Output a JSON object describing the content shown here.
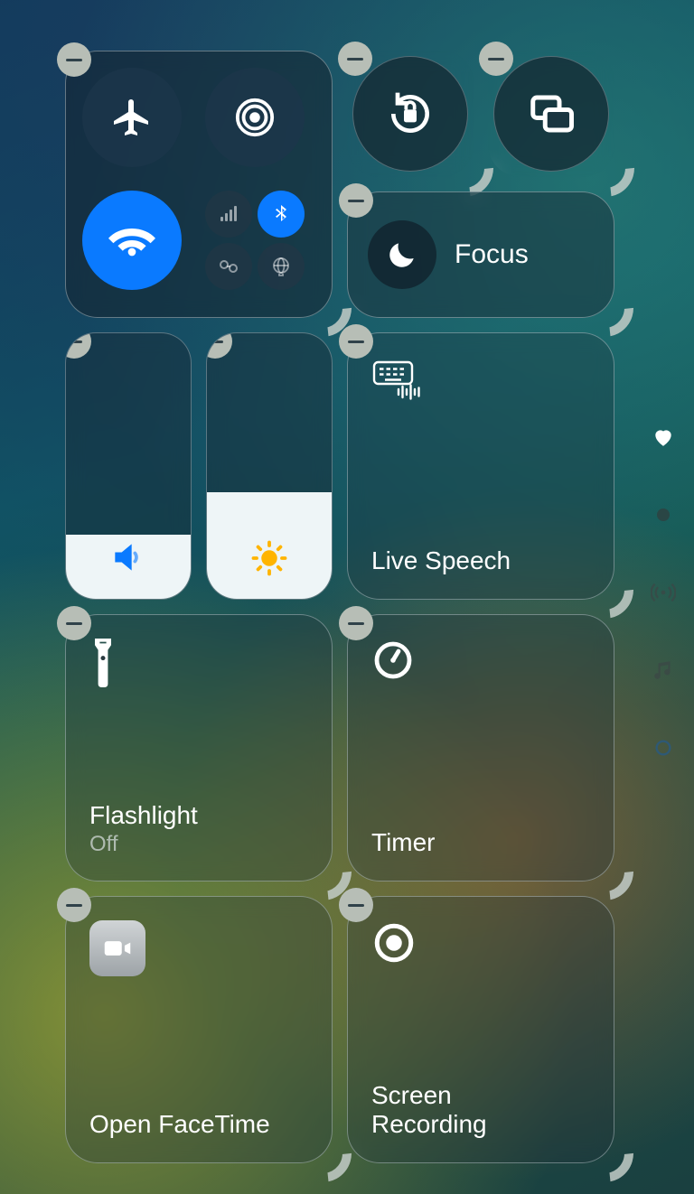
{
  "connectivity": {
    "airplane_on": false,
    "airdrop_on": false,
    "wifi_on": true,
    "cellular_on": false,
    "bluetooth_on": true,
    "hotspot_on": false,
    "vpn_on": false
  },
  "focus": {
    "label": "Focus"
  },
  "sliders": {
    "volume_percent": 24,
    "brightness_percent": 40
  },
  "live_speech": {
    "title": "Live Speech"
  },
  "flashlight": {
    "title": "Flashlight",
    "status": "Off"
  },
  "timer": {
    "title": "Timer"
  },
  "facetime": {
    "title": "Open FaceTime"
  },
  "screen_recording": {
    "title": "Screen\nRecording"
  },
  "colors": {
    "accent_blue": "#0a7aff",
    "tile_bg": "rgba(30,45,55,0.30)"
  }
}
